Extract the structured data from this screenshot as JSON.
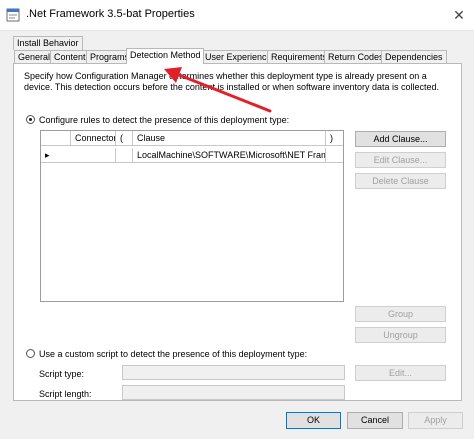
{
  "window": {
    "title": ".Net Framework 3.5-bat Properties"
  },
  "tabs_row1": [
    {
      "label": "Install Behavior"
    }
  ],
  "tabs_row2": [
    {
      "label": "General"
    },
    {
      "label": "Content"
    },
    {
      "label": "Programs"
    },
    {
      "label": "Detection Method"
    },
    {
      "label": "User Experience"
    },
    {
      "label": "Requirements"
    },
    {
      "label": "Return Codes"
    },
    {
      "label": "Dependencies"
    }
  ],
  "active_tab": "Detection Method",
  "description": "Specify how Configuration Manager determines whether this deployment type is already present on a device. This detection occurs before the content is installed or when software inventory data is collected.",
  "rules_option": {
    "label": "Configure rules to detect the presence of this deployment type:",
    "selected": true
  },
  "grid": {
    "columns": [
      "Connector",
      "(",
      "Clause",
      ")"
    ],
    "rows": [
      {
        "indicator": "▸",
        "connector": "",
        "paren_open": "",
        "clause": "LocalMachine\\SOFTWARE\\Microsoft\\NET Frame...",
        "paren_close": ""
      }
    ]
  },
  "clause_buttons": {
    "add": "Add Clause...",
    "edit": "Edit Clause...",
    "delete": "Delete Clause",
    "group": "Group",
    "ungroup": "Ungroup"
  },
  "script_option": {
    "label": "Use a custom script to detect the presence of this deployment type:",
    "selected": false
  },
  "script_type": {
    "label": "Script type:",
    "value": ""
  },
  "script_length": {
    "label": "Script length:",
    "value": ""
  },
  "edit_script_button": "Edit...",
  "footer": {
    "ok": "OK",
    "cancel": "Cancel",
    "apply": "Apply"
  },
  "colors": {
    "arrow": "#e0202a",
    "default_button_border": "#0078d7"
  }
}
